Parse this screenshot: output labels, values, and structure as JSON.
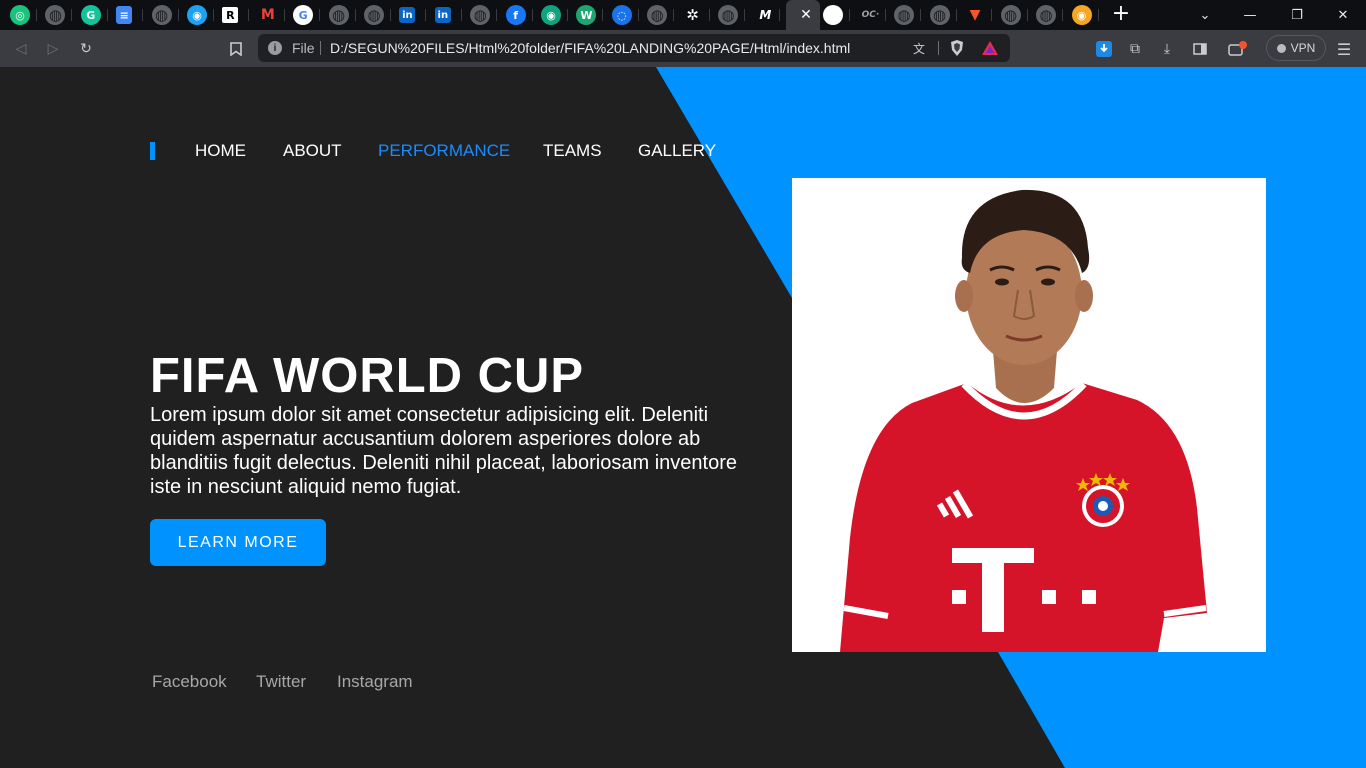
{
  "browser": {
    "tabs": [
      {
        "icon": "chatgpt-icon",
        "color": "#19c37d"
      },
      {
        "icon": "globe-icon",
        "color": "#5f6368"
      },
      {
        "icon": "grammarly-icon",
        "color": "#15c39a"
      },
      {
        "icon": "google-docs-icon",
        "color": "#4285f4"
      },
      {
        "icon": "globe-icon",
        "color": "#5f6368"
      },
      {
        "icon": "app-icon",
        "color": "#1da1f2"
      },
      {
        "icon": "researchgate-icon",
        "color": "#ffffff"
      },
      {
        "icon": "gmail-icon",
        "color": "#ea4335"
      },
      {
        "icon": "google-icon",
        "color": "#ffffff"
      },
      {
        "icon": "globe-icon",
        "color": "#5f6368"
      },
      {
        "icon": "globe-icon",
        "color": "#5f6368"
      },
      {
        "icon": "linkedin-icon",
        "color": "#0a66c2"
      },
      {
        "icon": "linkedin-icon",
        "color": "#0a66c2"
      },
      {
        "icon": "globe-icon",
        "color": "#5f6368"
      },
      {
        "icon": "facebook-icon",
        "color": "#1877f2"
      },
      {
        "icon": "app-icon",
        "color": "#10a37f"
      },
      {
        "icon": "webflow-icon",
        "color": "#1ea672"
      },
      {
        "icon": "loading-icon",
        "color": "#1a73e8"
      },
      {
        "icon": "globe-icon",
        "color": "#5f6368"
      },
      {
        "icon": "openai-icon",
        "color": "#ffffff"
      },
      {
        "icon": "globe-icon",
        "color": "#5f6368"
      },
      {
        "icon": "medium-icon",
        "color": "#ffffff"
      }
    ],
    "tabs_after_active": [
      {
        "icon": "app-icon",
        "color": "#ffffff"
      },
      {
        "icon": "oc-icon",
        "color": "#9aa0a6"
      },
      {
        "icon": "globe-icon",
        "color": "#5f6368"
      },
      {
        "icon": "globe-icon",
        "color": "#5f6368"
      },
      {
        "icon": "brave-icon",
        "color": "#fb542b"
      },
      {
        "icon": "globe-icon",
        "color": "#5f6368"
      },
      {
        "icon": "globe-icon",
        "color": "#5f6368"
      },
      {
        "icon": "app-icon",
        "color": "#f5a623"
      }
    ],
    "medium_glyph": "M",
    "oc_glyph": "OC·",
    "file_label": "File",
    "url": "D:/SEGUN%20FILES/Html%20folder/FIFA%20LANDING%20PAGE/Html/index.html",
    "vpn_label": "VPN"
  },
  "page": {
    "nav": {
      "items": [
        {
          "label": "HOME",
          "active": false
        },
        {
          "label": "ABOUT",
          "active": false
        },
        {
          "label": "PERFORMANCE",
          "active": true
        },
        {
          "label": "TEAMS",
          "active": false
        },
        {
          "label": "GALLERY",
          "active": false
        }
      ]
    },
    "hero": {
      "title": "FIFA WORLD CUP",
      "text": "Lorem ipsum dolor sit amet consectetur adipisicing elit. Deleniti quidem aspernatur accusantium dolorem asperiores dolore ab blanditiis fugit delectus. Deleniti nihil placeat, laboriosam inventore iste in nesciunt aliquid nemo fugiat.",
      "button_label": "LEARN MORE"
    },
    "social": [
      "Facebook",
      "Twitter",
      "Instagram"
    ],
    "colors": {
      "accent": "#0093ff",
      "background": "#202020",
      "jersey": "#d5142a"
    }
  }
}
